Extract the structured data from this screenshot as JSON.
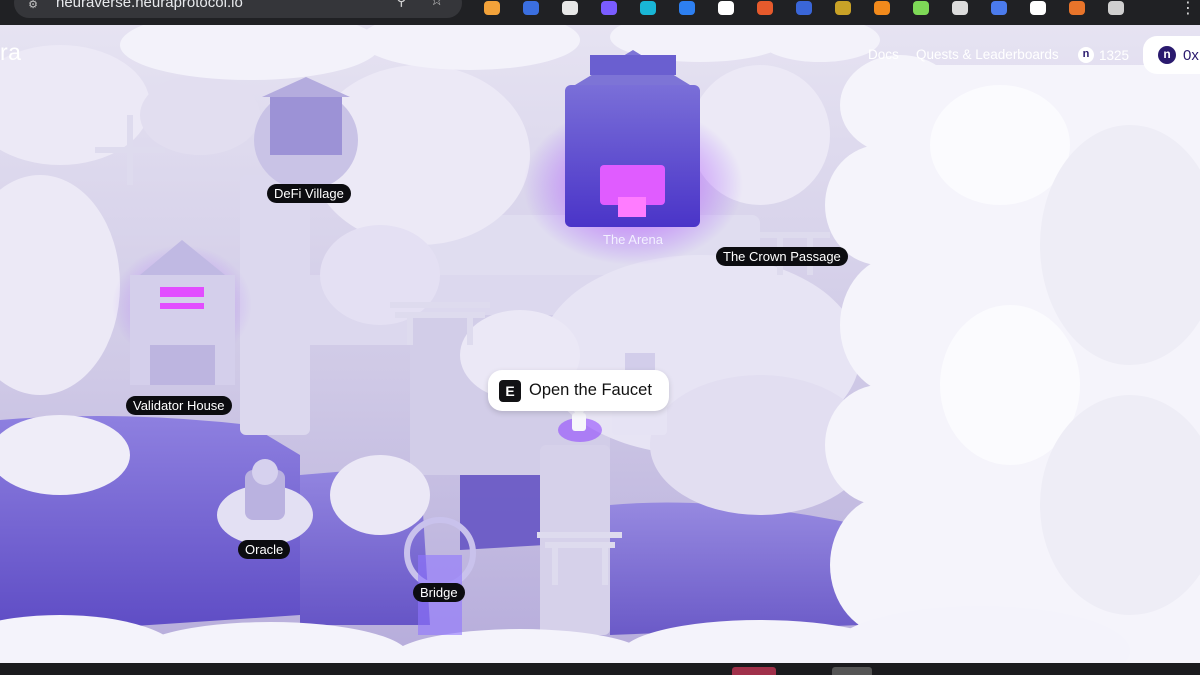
{
  "browser": {
    "url": "neuraverse.neuraprotocol.io",
    "extension_colors": [
      "#f2a23a",
      "#3b6fe0",
      "#e8e8e8",
      "#7a5cff",
      "#19b6d6",
      "#2d7ff0",
      "#ffffff",
      "#e65a2c",
      "#3a66d8",
      "#c9a227",
      "#f28a1c",
      "#7ed957",
      "#dcdcdc",
      "#4b7bec",
      "#ffffff",
      "#e8742a",
      "#cfcfcf"
    ]
  },
  "hud": {
    "logo": "ra",
    "nav": [
      "Docs",
      "Quests & Leaderboards"
    ],
    "points": "1325",
    "wallet_icon_glyph": "n",
    "wallet_text": "0x"
  },
  "map": {
    "locations": [
      "DeFi Village",
      "The Arena",
      "The Crown Passage",
      "Validator House",
      "Oracle",
      "Bridge"
    ],
    "accent": "#8a3dff",
    "glow": "#d94dff",
    "water": "#7a6ad6"
  },
  "prompt": {
    "key": "E",
    "text": "Open the Faucet"
  }
}
